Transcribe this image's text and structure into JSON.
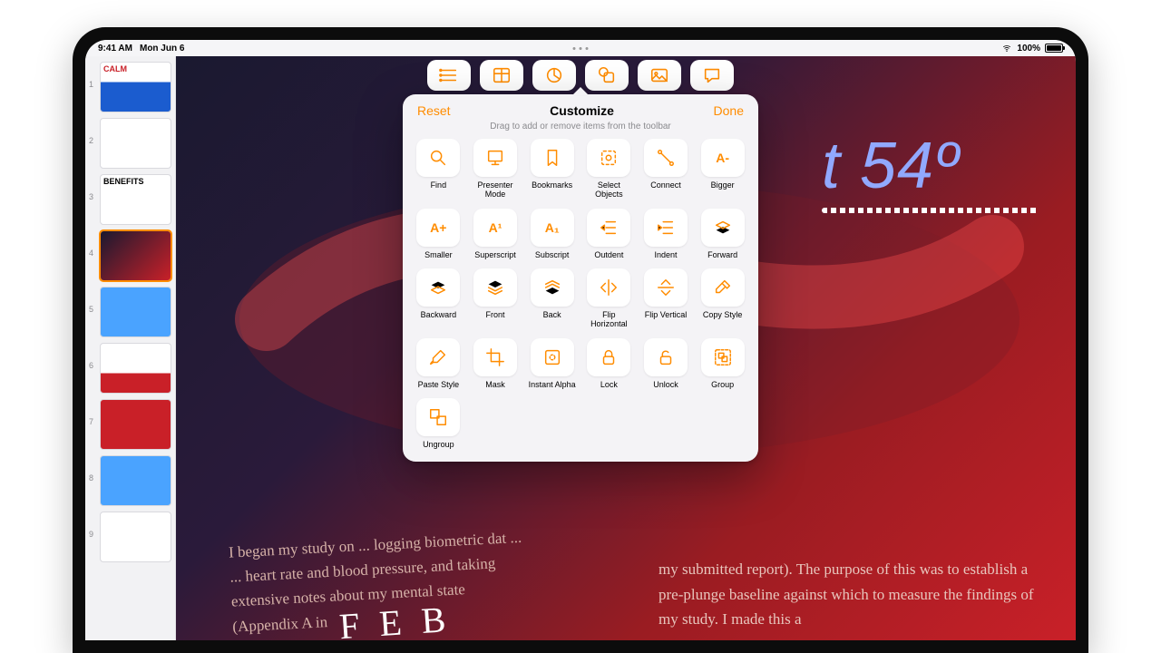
{
  "status": {
    "time": "9:41 AM",
    "date": "Mon Jun 6",
    "battery_pct": "100%"
  },
  "toolbar_current": [
    {
      "id": "list",
      "icon": "list"
    },
    {
      "id": "table",
      "icon": "table"
    },
    {
      "id": "chart",
      "icon": "pie"
    },
    {
      "id": "shapes",
      "icon": "shapes"
    },
    {
      "id": "media",
      "icon": "media"
    },
    {
      "id": "comment",
      "icon": "comment"
    }
  ],
  "popover": {
    "reset_label": "Reset",
    "title": "Customize",
    "done_label": "Done",
    "subtitle": "Drag to add or remove items from the toolbar"
  },
  "items": [
    {
      "id": "find",
      "label": "Find",
      "icon": "search"
    },
    {
      "id": "presenter-mode",
      "label": "Presenter Mode",
      "icon": "presenter"
    },
    {
      "id": "bookmarks",
      "label": "Bookmarks",
      "icon": "bookmark"
    },
    {
      "id": "select-objects",
      "label": "Select Objects",
      "icon": "select"
    },
    {
      "id": "connect",
      "label": "Connect",
      "icon": "connect"
    },
    {
      "id": "bigger",
      "label": "Bigger",
      "icon": "textA-",
      "text": "A-"
    },
    {
      "id": "smaller",
      "label": "Smaller",
      "icon": "textA+",
      "text": "A+"
    },
    {
      "id": "superscript",
      "label": "Superscript",
      "icon": "super",
      "text": "A¹"
    },
    {
      "id": "subscript",
      "label": "Subscript",
      "icon": "sub",
      "text": "A₁"
    },
    {
      "id": "outdent",
      "label": "Outdent",
      "icon": "outdent"
    },
    {
      "id": "indent",
      "label": "Indent",
      "icon": "indent"
    },
    {
      "id": "forward",
      "label": "Forward",
      "icon": "forward"
    },
    {
      "id": "backward",
      "label": "Backward",
      "icon": "backward"
    },
    {
      "id": "front",
      "label": "Front",
      "icon": "front"
    },
    {
      "id": "back",
      "label": "Back",
      "icon": "back"
    },
    {
      "id": "flip-horizontal",
      "label": "Flip Horizontal",
      "icon": "flip-h"
    },
    {
      "id": "flip-vertical",
      "label": "Flip Vertical",
      "icon": "flip-v"
    },
    {
      "id": "copy-style",
      "label": "Copy Style",
      "icon": "eyedropper"
    },
    {
      "id": "paste-style",
      "label": "Paste Style",
      "icon": "brush"
    },
    {
      "id": "mask",
      "label": "Mask",
      "icon": "crop"
    },
    {
      "id": "instant-alpha",
      "label": "Instant Alpha",
      "icon": "alpha"
    },
    {
      "id": "lock",
      "label": "Lock",
      "icon": "lock"
    },
    {
      "id": "unlock",
      "label": "Unlock",
      "icon": "unlock"
    },
    {
      "id": "group",
      "label": "Group",
      "icon": "group"
    },
    {
      "id": "ungroup",
      "label": "Ungroup",
      "icon": "ungroup"
    }
  ],
  "slides": [
    {
      "n": 1,
      "title": "CALM",
      "type": "calm"
    },
    {
      "n": 2,
      "title": "",
      "type": "text"
    },
    {
      "n": 3,
      "title": "BENEFITS",
      "type": "ben"
    },
    {
      "n": 4,
      "title": "",
      "type": "main",
      "selected": true
    },
    {
      "n": 5,
      "title": "",
      "type": "note"
    },
    {
      "n": 6,
      "title": "",
      "type": "card"
    },
    {
      "n": 7,
      "title": "",
      "type": "red"
    },
    {
      "n": 8,
      "title": "",
      "type": "note2"
    },
    {
      "n": 9,
      "title": "",
      "type": "plain"
    }
  ],
  "canvas": {
    "title_html": "t 54º",
    "body_left": "I began my study on ... logging biometric dat ... ... heart rate and blood pressure, and taking extensive notes about my mental state (Appendix A in",
    "body_right": "my submitted report). The purpose of this was to establish a pre-plunge baseline against which to measure the findings of my study. I made this a",
    "handnote": "F E B"
  }
}
